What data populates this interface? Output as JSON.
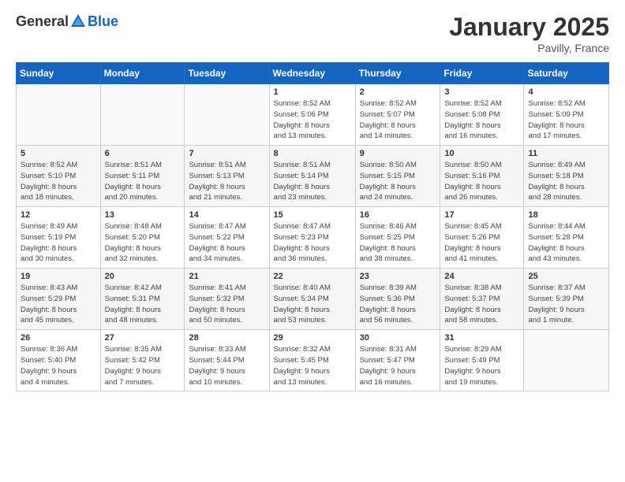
{
  "header": {
    "logo_general": "General",
    "logo_blue": "Blue",
    "title": "January 2025",
    "subtitle": "Pavilly, France"
  },
  "columns": [
    "Sunday",
    "Monday",
    "Tuesday",
    "Wednesday",
    "Thursday",
    "Friday",
    "Saturday"
  ],
  "weeks": [
    {
      "days": [
        {
          "num": "",
          "info": ""
        },
        {
          "num": "",
          "info": ""
        },
        {
          "num": "",
          "info": ""
        },
        {
          "num": "1",
          "info": "Sunrise: 8:52 AM\nSunset: 5:06 PM\nDaylight: 8 hours\nand 13 minutes."
        },
        {
          "num": "2",
          "info": "Sunrise: 8:52 AM\nSunset: 5:07 PM\nDaylight: 8 hours\nand 14 minutes."
        },
        {
          "num": "3",
          "info": "Sunrise: 8:52 AM\nSunset: 5:08 PM\nDaylight: 8 hours\nand 16 minutes."
        },
        {
          "num": "4",
          "info": "Sunrise: 8:52 AM\nSunset: 5:09 PM\nDaylight: 8 hours\nand 17 minutes."
        }
      ]
    },
    {
      "days": [
        {
          "num": "5",
          "info": "Sunrise: 8:52 AM\nSunset: 5:10 PM\nDaylight: 8 hours\nand 18 minutes."
        },
        {
          "num": "6",
          "info": "Sunrise: 8:51 AM\nSunset: 5:11 PM\nDaylight: 8 hours\nand 20 minutes."
        },
        {
          "num": "7",
          "info": "Sunrise: 8:51 AM\nSunset: 5:13 PM\nDaylight: 8 hours\nand 21 minutes."
        },
        {
          "num": "8",
          "info": "Sunrise: 8:51 AM\nSunset: 5:14 PM\nDaylight: 8 hours\nand 23 minutes."
        },
        {
          "num": "9",
          "info": "Sunrise: 8:50 AM\nSunset: 5:15 PM\nDaylight: 8 hours\nand 24 minutes."
        },
        {
          "num": "10",
          "info": "Sunrise: 8:50 AM\nSunset: 5:16 PM\nDaylight: 8 hours\nand 26 minutes."
        },
        {
          "num": "11",
          "info": "Sunrise: 8:49 AM\nSunset: 5:18 PM\nDaylight: 8 hours\nand 28 minutes."
        }
      ]
    },
    {
      "days": [
        {
          "num": "12",
          "info": "Sunrise: 8:49 AM\nSunset: 5:19 PM\nDaylight: 8 hours\nand 30 minutes."
        },
        {
          "num": "13",
          "info": "Sunrise: 8:48 AM\nSunset: 5:20 PM\nDaylight: 8 hours\nand 32 minutes."
        },
        {
          "num": "14",
          "info": "Sunrise: 8:47 AM\nSunset: 5:22 PM\nDaylight: 8 hours\nand 34 minutes."
        },
        {
          "num": "15",
          "info": "Sunrise: 8:47 AM\nSunset: 5:23 PM\nDaylight: 8 hours\nand 36 minutes."
        },
        {
          "num": "16",
          "info": "Sunrise: 8:46 AM\nSunset: 5:25 PM\nDaylight: 8 hours\nand 38 minutes."
        },
        {
          "num": "17",
          "info": "Sunrise: 8:45 AM\nSunset: 5:26 PM\nDaylight: 8 hours\nand 41 minutes."
        },
        {
          "num": "18",
          "info": "Sunrise: 8:44 AM\nSunset: 5:28 PM\nDaylight: 8 hours\nand 43 minutes."
        }
      ]
    },
    {
      "days": [
        {
          "num": "19",
          "info": "Sunrise: 8:43 AM\nSunset: 5:29 PM\nDaylight: 8 hours\nand 45 minutes."
        },
        {
          "num": "20",
          "info": "Sunrise: 8:42 AM\nSunset: 5:31 PM\nDaylight: 8 hours\nand 48 minutes."
        },
        {
          "num": "21",
          "info": "Sunrise: 8:41 AM\nSunset: 5:32 PM\nDaylight: 8 hours\nand 50 minutes."
        },
        {
          "num": "22",
          "info": "Sunrise: 8:40 AM\nSunset: 5:34 PM\nDaylight: 8 hours\nand 53 minutes."
        },
        {
          "num": "23",
          "info": "Sunrise: 8:39 AM\nSunset: 5:36 PM\nDaylight: 8 hours\nand 56 minutes."
        },
        {
          "num": "24",
          "info": "Sunrise: 8:38 AM\nSunset: 5:37 PM\nDaylight: 8 hours\nand 58 minutes."
        },
        {
          "num": "25",
          "info": "Sunrise: 8:37 AM\nSunset: 5:39 PM\nDaylight: 9 hours\nand 1 minute."
        }
      ]
    },
    {
      "days": [
        {
          "num": "26",
          "info": "Sunrise: 8:36 AM\nSunset: 5:40 PM\nDaylight: 9 hours\nand 4 minutes."
        },
        {
          "num": "27",
          "info": "Sunrise: 8:35 AM\nSunset: 5:42 PM\nDaylight: 9 hours\nand 7 minutes."
        },
        {
          "num": "28",
          "info": "Sunrise: 8:33 AM\nSunset: 5:44 PM\nDaylight: 9 hours\nand 10 minutes."
        },
        {
          "num": "29",
          "info": "Sunrise: 8:32 AM\nSunset: 5:45 PM\nDaylight: 9 hours\nand 13 minutes."
        },
        {
          "num": "30",
          "info": "Sunrise: 8:31 AM\nSunset: 5:47 PM\nDaylight: 9 hours\nand 16 minutes."
        },
        {
          "num": "31",
          "info": "Sunrise: 8:29 AM\nSunset: 5:49 PM\nDaylight: 9 hours\nand 19 minutes."
        },
        {
          "num": "",
          "info": ""
        }
      ]
    }
  ]
}
